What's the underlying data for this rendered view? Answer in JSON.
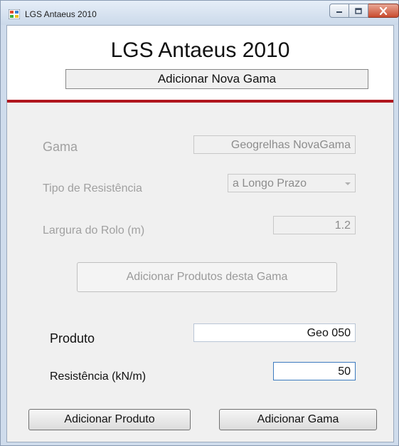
{
  "window": {
    "title": "LGS Antaeus 2010",
    "caption_buttons": [
      "minimize-icon",
      "maximize-icon",
      "close-icon"
    ]
  },
  "header": {
    "app_title": "LGS Antaeus 2010",
    "subtitle": "Adicionar Nova Gama"
  },
  "form": {
    "gama": {
      "label": "Gama",
      "value": "Geogrelhas NovaGama"
    },
    "tipo_resistencia": {
      "label": "Tipo de Resistência",
      "selected": "a Longo Prazo"
    },
    "largura_rolo": {
      "label": "Largura do Rolo (m)",
      "value": "1.2"
    },
    "add_products_button": "Adicionar Produtos desta Gama",
    "produto": {
      "label": "Produto",
      "value": "Geo 050"
    },
    "resistencia": {
      "label": "Resistência (kN/m)",
      "value": "50"
    }
  },
  "buttons": {
    "add_product": "Adicionar Produto",
    "add_gama": "Adicionar Gama"
  },
  "colors": {
    "accent_line": "#b0161e",
    "close_button": "#c94b2e"
  }
}
